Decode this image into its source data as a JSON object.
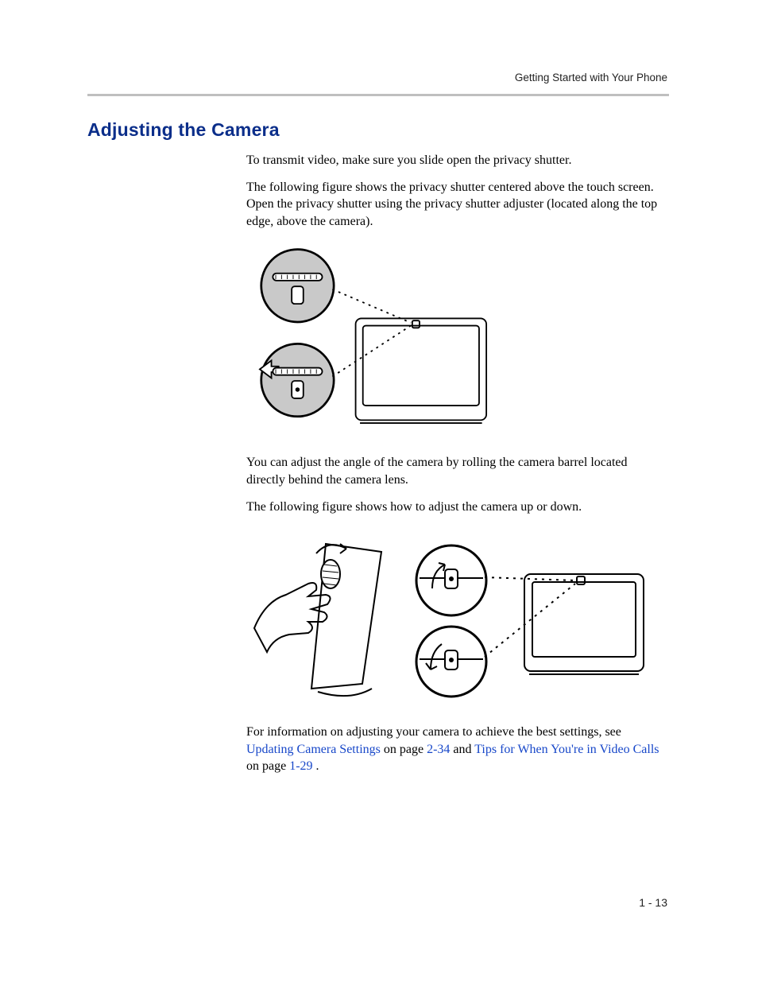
{
  "running_head": "Getting Started with Your Phone",
  "section_title": "Adjusting the Camera",
  "p1": "To transmit video, make sure you slide open the privacy shutter.",
  "p2": "The following figure shows the privacy shutter centered above the touch screen. Open the privacy shutter using the privacy shutter adjuster (located along the top edge, above the camera).",
  "p3": "You can adjust the angle of the camera by rolling the camera barrel located directly behind the camera lens.",
  "p4": "The following figure shows how to adjust the camera up or down.",
  "p5_lead": "For information on adjusting your camera to achieve the best settings, see ",
  "link1": "Updating Camera Settings",
  "p5_mid1": " on page ",
  "pg1": "2-34",
  "p5_and": " and ",
  "link2": "Tips for When You're in Video Calls",
  "p5_mid2": " on page ",
  "pg2": "1-29",
  "p5_end": ".",
  "page_number": "1 - 13"
}
